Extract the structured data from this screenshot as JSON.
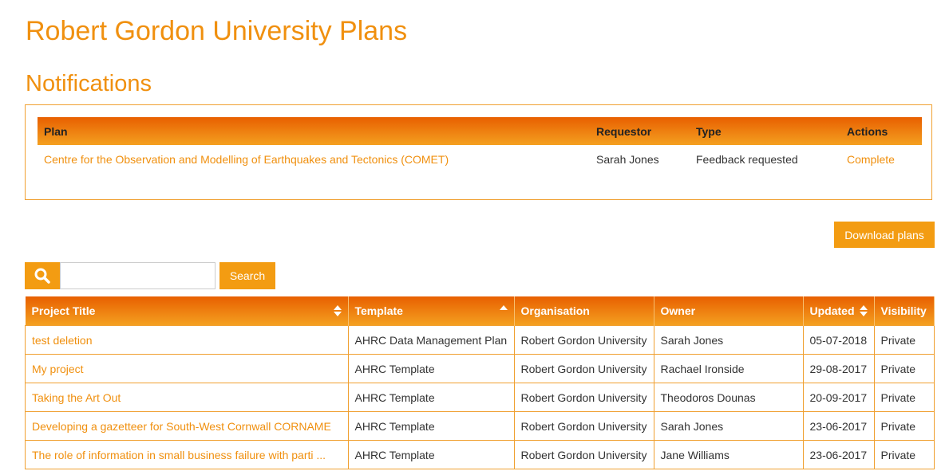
{
  "page": {
    "title": "Robert Gordon University Plans"
  },
  "notifications": {
    "title": "Notifications",
    "headers": [
      "Plan",
      "Requestor",
      "Type",
      "Actions"
    ],
    "rows": [
      {
        "plan": "Centre for the Observation and Modelling of Earthquakes and Tectonics (COMET)",
        "requestor": "Sarah Jones",
        "type": "Feedback requested",
        "action": "Complete"
      }
    ]
  },
  "toolbar": {
    "download_label": "Download plans"
  },
  "search": {
    "button_label": "Search",
    "value": ""
  },
  "plans": {
    "headers": {
      "title": "Project Title",
      "template": "Template",
      "organisation": "Organisation",
      "owner": "Owner",
      "updated": "Updated",
      "visibility": "Visibility"
    },
    "rows": [
      {
        "title": "test deletion",
        "template": "AHRC Data Management Plan",
        "organisation": "Robert Gordon University",
        "owner": "Sarah Jones",
        "updated": "05-07-2018",
        "visibility": "Private"
      },
      {
        "title": "My project",
        "template": "AHRC Template",
        "organisation": "Robert Gordon University",
        "owner": "Rachael Ironside",
        "updated": "29-08-2017",
        "visibility": "Private"
      },
      {
        "title": "Taking the Art Out",
        "template": "AHRC Template",
        "organisation": "Robert Gordon University",
        "owner": "Theodoros Dounas",
        "updated": "20-09-2017",
        "visibility": "Private"
      },
      {
        "title": "Developing a gazetteer for South-West Cornwall CORNAME",
        "template": "AHRC Template",
        "organisation": "Robert Gordon University",
        "owner": "Sarah Jones",
        "updated": "23-06-2017",
        "visibility": "Private"
      },
      {
        "title": "The role of information in small business failure with parti ...",
        "template": "AHRC Template",
        "organisation": "Robert Gordon University",
        "owner": "Jane Williams",
        "updated": "23-06-2017",
        "visibility": "Private"
      }
    ]
  },
  "icons": {
    "search": "search-icon",
    "sort": "sort-icon",
    "sort_asc": "sort-asc-icon"
  },
  "colors": {
    "accent": "#f39c12",
    "header_start": "#e85f00",
    "header_end": "#f4a020"
  }
}
